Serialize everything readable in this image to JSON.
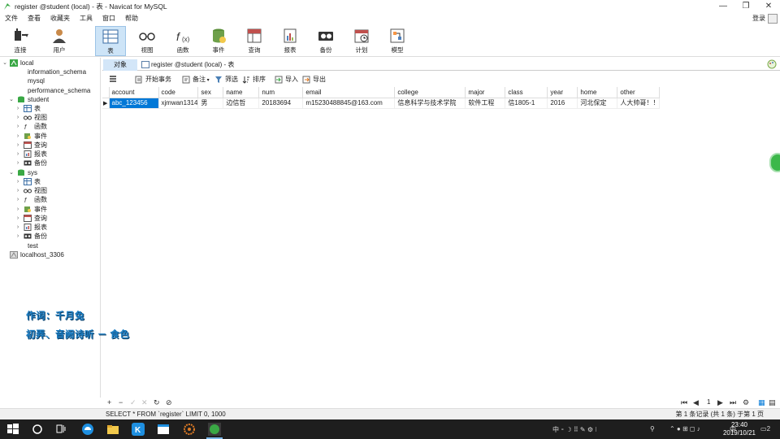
{
  "window": {
    "title": "register @student (local) - 表 - Navicat for MySQL",
    "controls": [
      "—",
      "❐",
      "✕"
    ]
  },
  "menu": {
    "items": [
      "文件",
      "查看",
      "收藏夹",
      "工具",
      "窗口",
      "帮助"
    ],
    "login": "登录"
  },
  "toolbar": {
    "buttons": [
      {
        "label": "连接",
        "icon": "connect-icon"
      },
      {
        "label": "用户",
        "icon": "user-icon"
      },
      {
        "label": "表",
        "icon": "table-icon",
        "active": true
      },
      {
        "label": "视图",
        "icon": "view-icon"
      },
      {
        "label": "函数",
        "icon": "function-icon"
      },
      {
        "label": "事件",
        "icon": "event-icon"
      },
      {
        "label": "查询",
        "icon": "query-icon"
      },
      {
        "label": "报表",
        "icon": "report-icon"
      },
      {
        "label": "备份",
        "icon": "backup-icon"
      },
      {
        "label": "计划",
        "icon": "schedule-icon"
      },
      {
        "label": "模型",
        "icon": "model-icon"
      }
    ]
  },
  "nav": {
    "local": "local",
    "dbs": [
      "information_schema",
      "mysql",
      "performance_schema"
    ],
    "student": "student",
    "student_items": [
      "表",
      "视图",
      "函数",
      "事件",
      "查询",
      "报表",
      "备份"
    ],
    "sys": "sys",
    "sys_items": [
      "表",
      "视图",
      "函数",
      "事件",
      "查询",
      "报表",
      "备份"
    ],
    "test": "test",
    "localhost": "localhost_3306"
  },
  "tabs": {
    "objects": "对象",
    "register": "register @student (local) - 表"
  },
  "subbar": {
    "begin_tx": "开始事务",
    "memo": "备注",
    "filter": "筛选",
    "sort": "排序",
    "import": "导入",
    "export": "导出"
  },
  "grid": {
    "columns": [
      "account",
      "code",
      "sex",
      "name",
      "num",
      "email",
      "college",
      "major",
      "class",
      "year",
      "home",
      "other"
    ],
    "rows": [
      [
        "abc_123456",
        "xjmwan1314",
        "男",
        "边信哲",
        "20183694",
        "m15230488845@163.com",
        "信息科学与技术学院",
        "软件工程",
        "信1805-1",
        "2016",
        "河北保定",
        "人大帅哥！！"
      ]
    ]
  },
  "lyrics": {
    "line1": "作词：千月兔",
    "line2": "初弄、音阙诗听 － 食色"
  },
  "recnav": {
    "page": "1"
  },
  "status": {
    "sql": "SELECT * FROM `register` LIMIT 0, 1000",
    "records": "第 1 条记录 (共 1 条) 于第 1 页"
  },
  "taskbar": {
    "time": "23:40",
    "date": "2019/10/21",
    "notif": "2"
  },
  "colors": {
    "accent": "#0078d7",
    "tab_active": "#d3e6f8",
    "lyric": "#1f7fc4"
  }
}
